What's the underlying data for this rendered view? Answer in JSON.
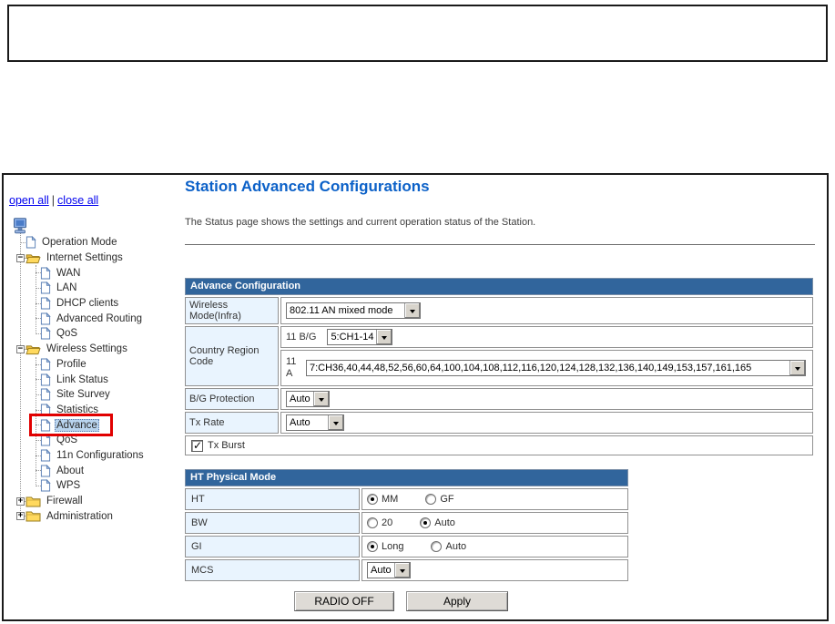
{
  "colors": {
    "header_blue": "#31659C",
    "cell_blue": "#E9F4FE",
    "title_blue": "#0C61C8",
    "link_blue": "#0000EE",
    "selection_blue": "#B9D4EE",
    "annotation_red": "#E10000"
  },
  "sidebar": {
    "open_all": "open all",
    "separator": "|",
    "close_all": "close all",
    "tree": [
      {
        "id": "root-computer",
        "label": "",
        "type": "computer",
        "level": 0
      },
      {
        "id": "operation-mode",
        "label": "Operation Mode",
        "type": "page",
        "level": 1
      },
      {
        "id": "internet-settings",
        "label": "Internet Settings",
        "type": "folder-open",
        "level": 1,
        "expander": "minus"
      },
      {
        "id": "wan",
        "label": "WAN",
        "type": "page",
        "level": 2
      },
      {
        "id": "lan",
        "label": "LAN",
        "type": "page",
        "level": 2
      },
      {
        "id": "dhcp-clients",
        "label": "DHCP clients",
        "type": "page",
        "level": 2
      },
      {
        "id": "advanced-routing",
        "label": "Advanced Routing",
        "type": "page",
        "level": 2
      },
      {
        "id": "qos-internet",
        "label": "QoS",
        "type": "page",
        "level": 2
      },
      {
        "id": "wireless-settings",
        "label": "Wireless Settings",
        "type": "folder-open",
        "level": 1,
        "expander": "minus"
      },
      {
        "id": "profile",
        "label": "Profile",
        "type": "page",
        "level": 2
      },
      {
        "id": "link-status",
        "label": "Link Status",
        "type": "page",
        "level": 2
      },
      {
        "id": "site-survey",
        "label": "Site Survey",
        "type": "page",
        "level": 2
      },
      {
        "id": "statistics",
        "label": "Statistics",
        "type": "page",
        "level": 2
      },
      {
        "id": "advance",
        "label": "Advance",
        "type": "page",
        "level": 2,
        "selected": true,
        "annotated": true
      },
      {
        "id": "qos-wireless",
        "label": "QoS",
        "type": "page",
        "level": 2
      },
      {
        "id": "11n-configurations",
        "label": "11n Configurations",
        "type": "page",
        "level": 2
      },
      {
        "id": "about",
        "label": "About",
        "type": "page",
        "level": 2
      },
      {
        "id": "wps",
        "label": "WPS",
        "type": "page",
        "level": 2
      },
      {
        "id": "firewall",
        "label": "Firewall",
        "type": "folder-closed",
        "level": 1,
        "expander": "plus"
      },
      {
        "id": "administration",
        "label": "Administration",
        "type": "folder-closed",
        "level": 1,
        "expander": "plus"
      }
    ]
  },
  "main": {
    "title": "Station Advanced Configurations",
    "description": "The Status page shows the settings and current operation status of the Station.",
    "advance_config": {
      "header": "Advance Configuration",
      "wireless_mode_label": "Wireless Mode(Infra)",
      "wireless_mode_value": "802.11 AN mixed mode",
      "country_region_label": "Country Region Code",
      "band_bg_label": "11 B/G",
      "band_bg_value": "5:CH1-14",
      "band_a_label": "11 A",
      "band_a_value": "7:CH36,40,44,48,52,56,60,64,100,104,108,112,116,120,124,128,132,136,140,149,153,157,161,165",
      "bg_protection_label": "B/G Protection",
      "bg_protection_value": "Auto",
      "tx_rate_label": "Tx Rate",
      "tx_rate_value": "Auto",
      "tx_burst_label": "Tx Burst",
      "tx_burst_checked": true
    },
    "ht_physical_mode": {
      "header": "HT Physical Mode",
      "rows": [
        {
          "label": "HT",
          "options": [
            {
              "label": "MM",
              "selected": true
            },
            {
              "label": "GF",
              "selected": false
            }
          ]
        },
        {
          "label": "BW",
          "options": [
            {
              "label": "20",
              "selected": false
            },
            {
              "label": "Auto",
              "selected": true
            }
          ]
        },
        {
          "label": "GI",
          "options": [
            {
              "label": "Long",
              "selected": true
            },
            {
              "label": "Auto",
              "selected": false
            }
          ]
        }
      ],
      "mcs_label": "MCS",
      "mcs_value": "Auto"
    },
    "buttons": {
      "radio_off": "RADIO OFF",
      "apply": "Apply"
    }
  }
}
